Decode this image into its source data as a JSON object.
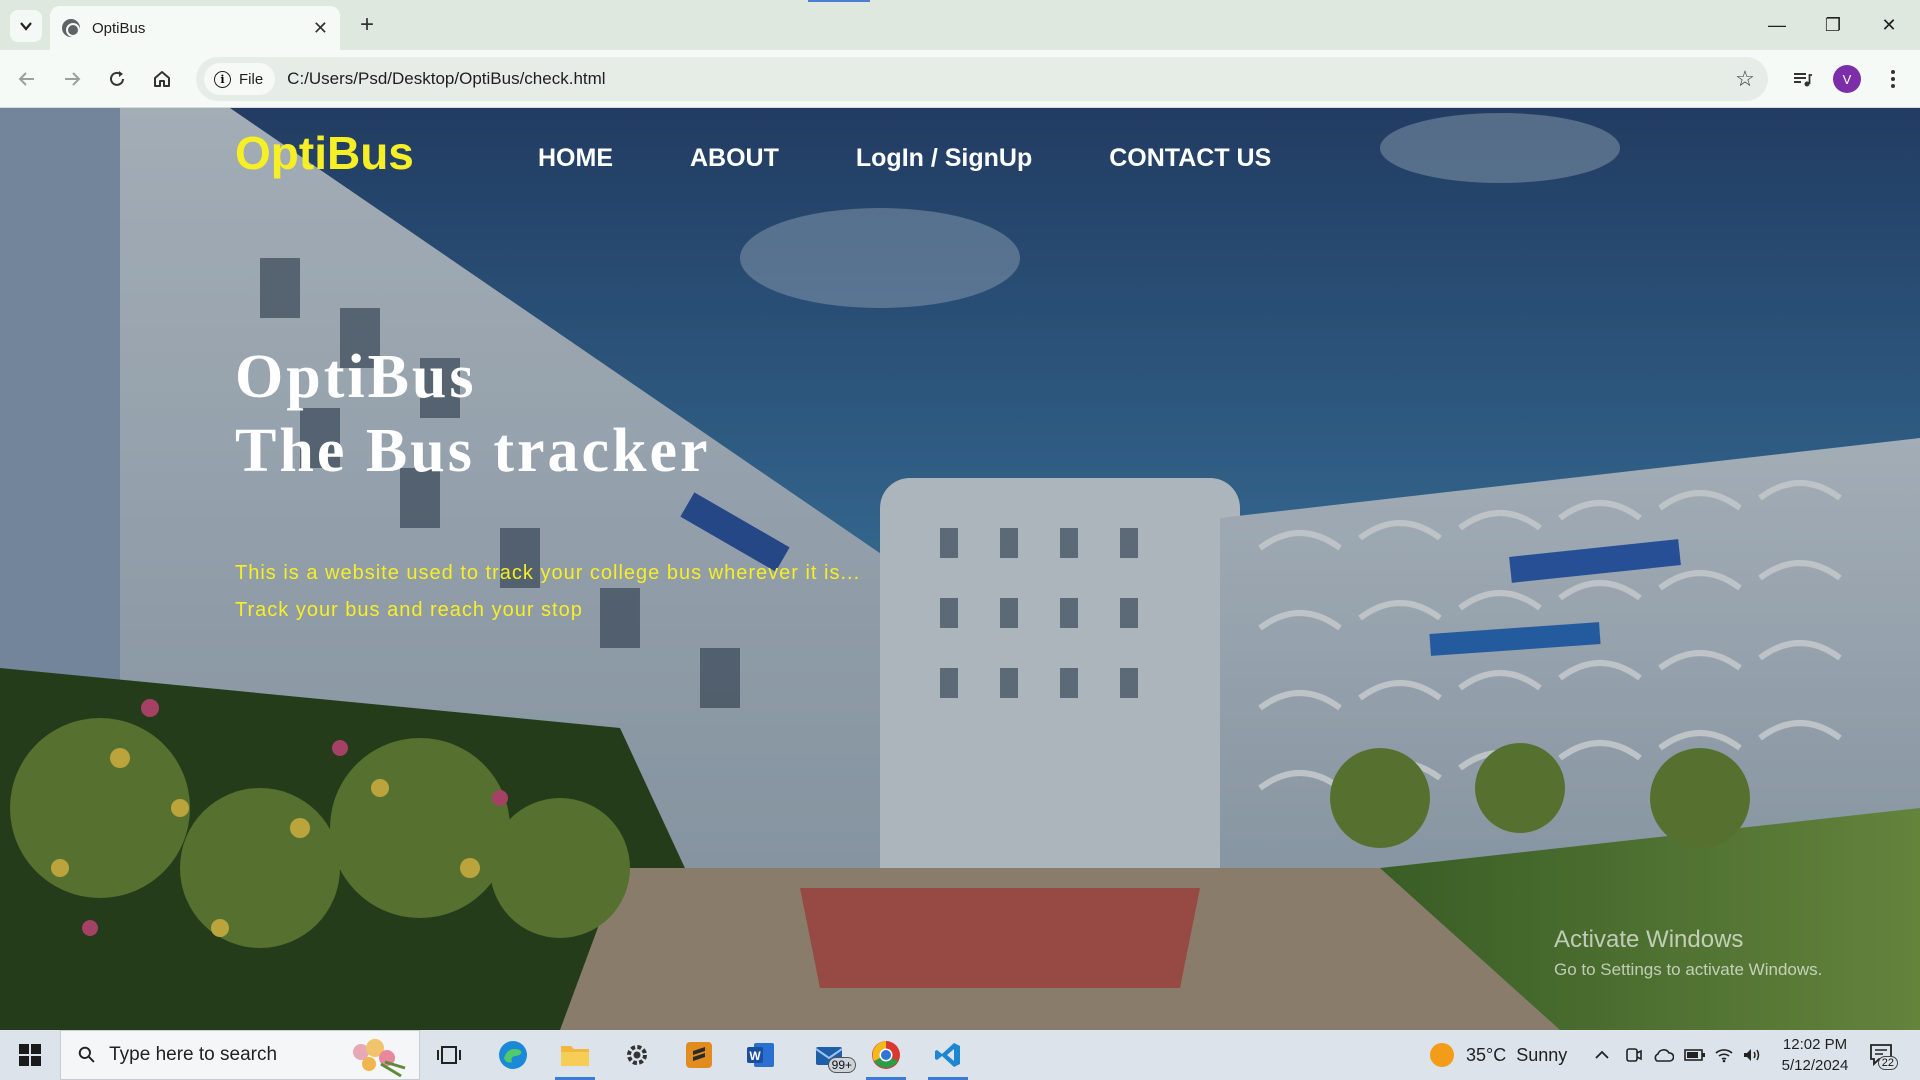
{
  "browser": {
    "tab": {
      "title": "OptiBus",
      "close_glyph": "✕"
    },
    "new_tab_glyph": "+",
    "window_controls": {
      "minimize": "—",
      "maximize": "❐",
      "close": "✕"
    },
    "address": {
      "chip_label": "File",
      "url": "C:/Users/Psd/Desktop/OptiBus/check.html"
    },
    "profile_initial": "V"
  },
  "page": {
    "brand": "OptiBus",
    "nav": [
      "HOME",
      "ABOUT",
      "LogIn / SignUp",
      "CONTACT US"
    ],
    "hero": {
      "line1": "OptiBus",
      "line2": "The Bus tracker"
    },
    "taglines": [
      "This is a website used to track your college bus wherever it is...",
      "Track your bus and reach your stop"
    ],
    "colors": {
      "brand": "#f6ef25",
      "nav": "#ffffff",
      "tagline": "#f6ef25"
    }
  },
  "watermark": {
    "line1": "Activate Windows",
    "line2": "Go to Settings to activate Windows."
  },
  "taskbar": {
    "search_placeholder": "Type here to search",
    "mail_badge": "99+",
    "weather": "35°C  Sunny",
    "time": "12:02 PM",
    "date": "5/12/2024",
    "notification_count": "22",
    "pinned_icons": [
      "task-view-icon",
      "edge-icon",
      "file-explorer-icon",
      "settings-icon",
      "sublime-icon",
      "word-icon",
      "mail-icon",
      "chrome-icon",
      "vscode-icon"
    ]
  }
}
